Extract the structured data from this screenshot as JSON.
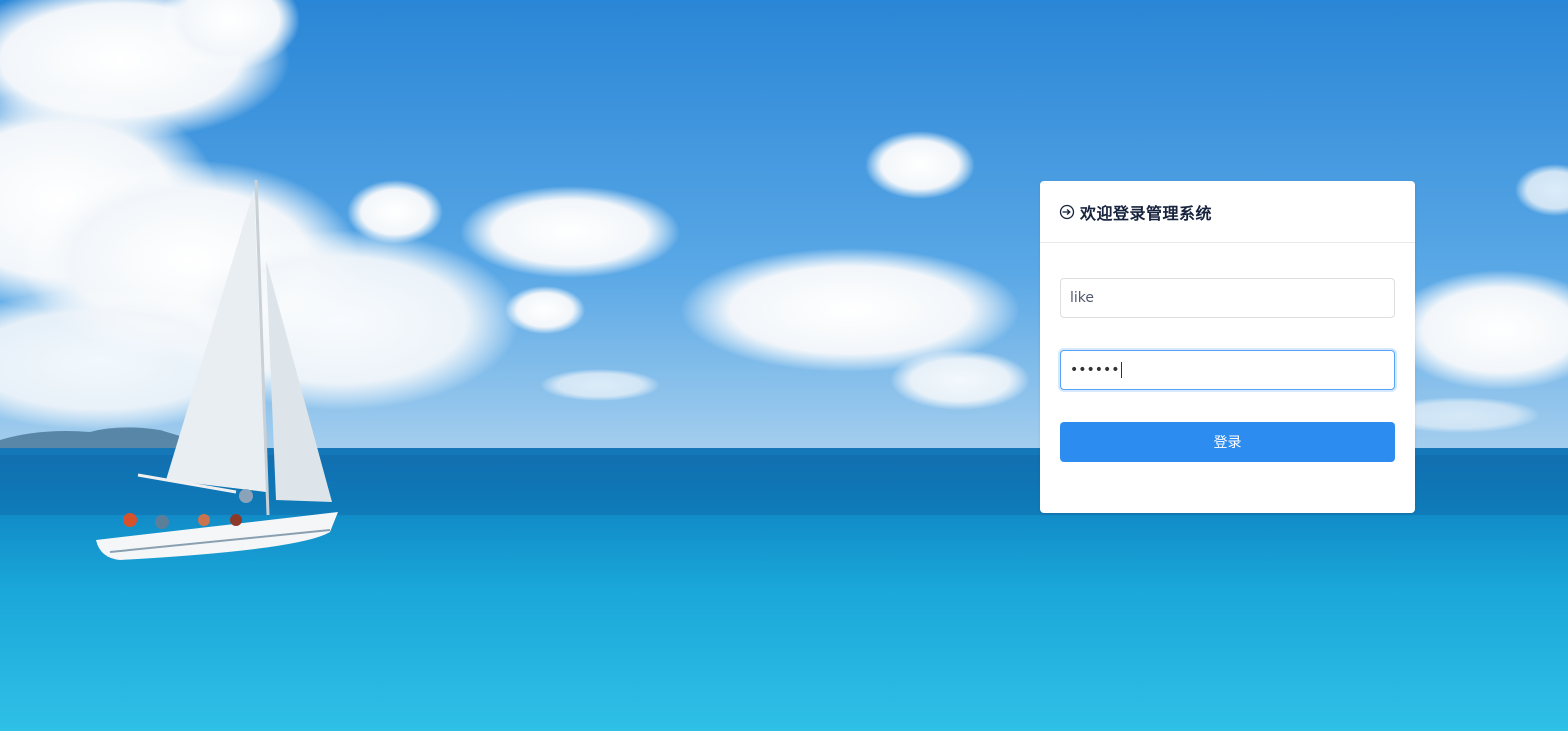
{
  "login": {
    "title": "欢迎登录管理系统",
    "username_value": "like",
    "password_mask": "••••••",
    "submit_label": "登录"
  },
  "icons": {
    "header": "login-icon"
  },
  "colors": {
    "primary": "#2d8cf0",
    "title": "#17233d",
    "border": "#dcdee2",
    "focus_border": "#57a3f3"
  }
}
